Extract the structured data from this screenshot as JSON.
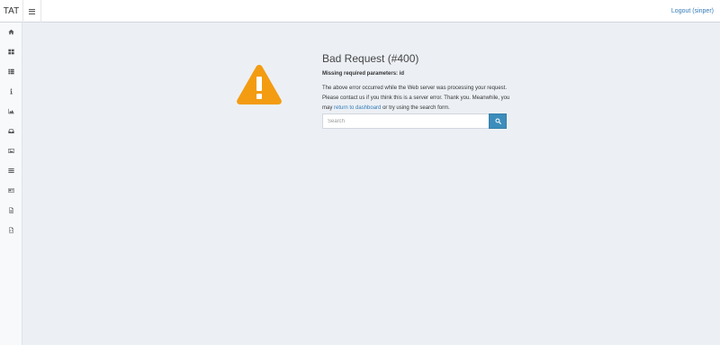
{
  "brand": "TAT",
  "header": {
    "logout_label": "Logout (sinper)"
  },
  "sidebar": {
    "items": [
      {
        "icon": "home-icon"
      },
      {
        "icon": "dashboard-grid-icon"
      },
      {
        "icon": "list-icon"
      },
      {
        "icon": "info-icon"
      },
      {
        "icon": "area-chart-icon"
      },
      {
        "icon": "inbox-icon"
      },
      {
        "icon": "image-icon"
      },
      {
        "icon": "bars-icon"
      },
      {
        "icon": "id-card-icon"
      },
      {
        "icon": "file-text-icon"
      },
      {
        "icon": "file-code-icon"
      }
    ]
  },
  "error": {
    "title": "Bad Request (#400)",
    "subtitle": "Missing required parameters: id",
    "message_part1": "The above error occurred while the Web server was processing your request. Please contact us if you think this is a server error. Thank you. Meanwhile, you may",
    "link_text": "return to dashboard",
    "message_part2": "or try using the search form."
  },
  "search": {
    "placeholder": "Search"
  },
  "colors": {
    "warning": "#f39c12",
    "primary": "#3c8dbc",
    "background": "#ecf0f5",
    "link": "#337ab7"
  }
}
